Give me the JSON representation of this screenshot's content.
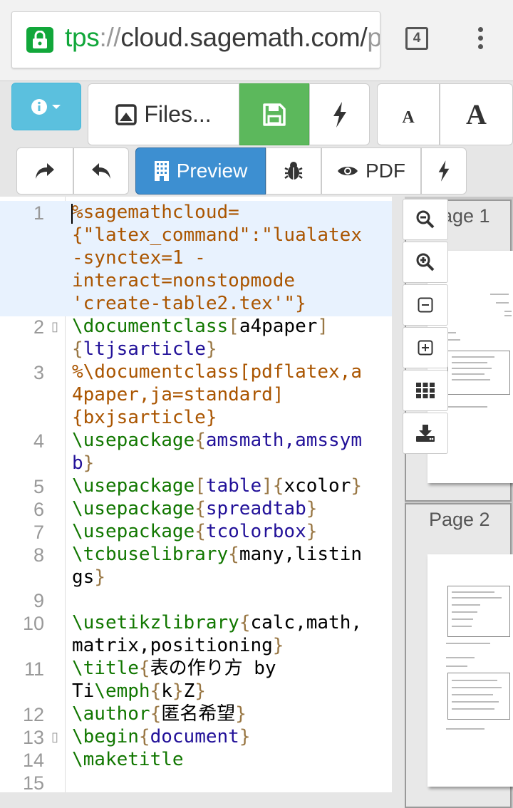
{
  "browser": {
    "url_scheme": "tps",
    "url_sep": "://",
    "url_host": "cloud.sagemath.com/",
    "url_tail": "p",
    "tab_count": "4"
  },
  "toolbar1": {
    "files_label": "Files...",
    "font_small": "A",
    "font_large": "A"
  },
  "toolbar2": {
    "preview_label": "Preview",
    "pdf_label": "PDF"
  },
  "editor": {
    "lines": [
      {
        "num": "1",
        "rows": [
          [
            "c-comment",
            "%sagemathcloud="
          ],
          [
            "c-comment",
            "{\"latex_command\":\"lualatex"
          ],
          [
            "c-comment",
            "-synctex=1 -"
          ],
          [
            "c-comment",
            "interact=nonstopmode"
          ],
          [
            "c-comment",
            "'create-table2.tex'\"}"
          ]
        ]
      },
      {
        "num": "2",
        "rows": [
          [
            "c-kw",
            "\\documentclass"
          ]
        ],
        "fold": true
      },
      {
        "num": "3",
        "rows": [
          [
            "c-comment",
            "%\\documentclass[pdflatex,a"
          ],
          [
            "c-comment",
            "4paper,ja=standard]"
          ],
          [
            "c-comment",
            "{bxjsarticle}"
          ]
        ]
      },
      {
        "num": "4"
      },
      {
        "num": "5"
      },
      {
        "num": "6"
      },
      {
        "num": "7"
      },
      {
        "num": "8"
      },
      {
        "num": "9"
      },
      {
        "num": "10"
      },
      {
        "num": "11"
      },
      {
        "num": "12"
      },
      {
        "num": "13",
        "fold": true
      },
      {
        "num": "14"
      },
      {
        "num": "15"
      }
    ]
  },
  "preview": {
    "page1_title": "Page 1",
    "page2_title": "Page 2"
  },
  "zoom": {
    "zoom_out_icon": "zoom-out-icon",
    "zoom_in_icon": "zoom-in-icon",
    "shrink_icon": "minus-square-icon",
    "grow_icon": "plus-square-icon",
    "grid_icon": "th-icon",
    "download_icon": "download-icon"
  }
}
